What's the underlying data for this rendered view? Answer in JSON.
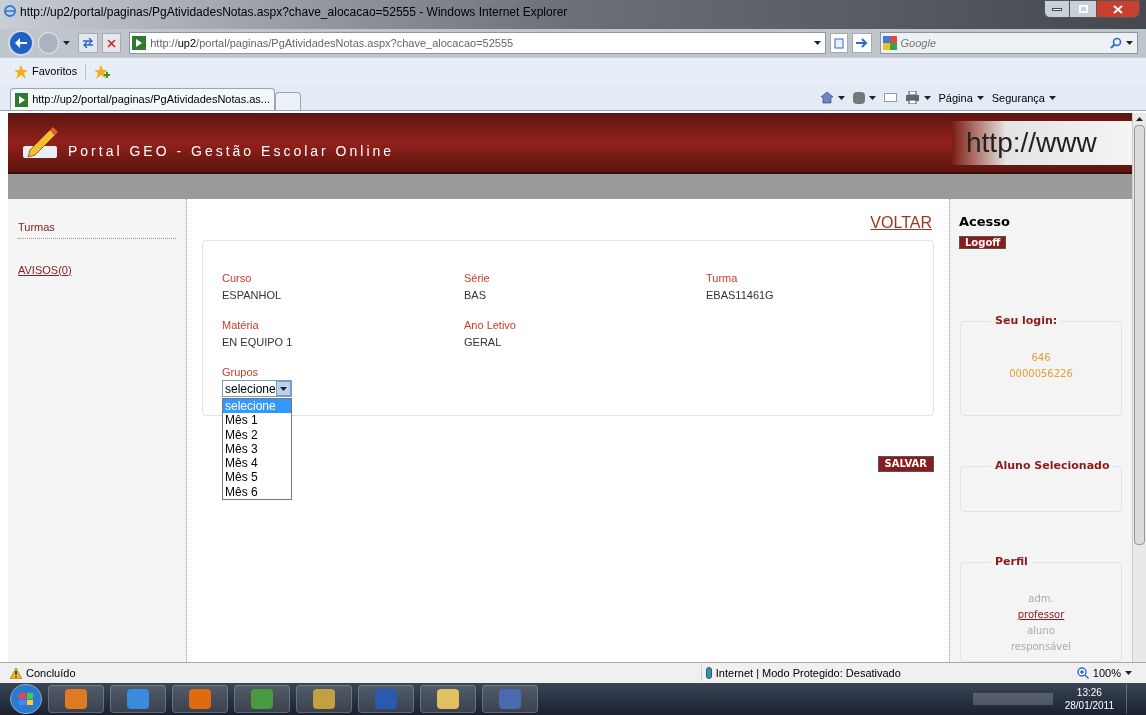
{
  "browser": {
    "title": "http://up2/portal/paginas/PgAtividadesNotas.aspx?chave_alocacao=52555 - Windows Internet Explorer",
    "address": {
      "prefix": "http://",
      "host": "up2",
      "path": "/portal/paginas/PgAtividadesNotas.aspx?chave_alocacao=52555"
    },
    "search": {
      "placeholder": "Google"
    },
    "favorites": "Favoritos",
    "tabs": [
      {
        "label": "http://up2/portal/paginas/PgAtividadesNotas.as...",
        "selected": true
      }
    ],
    "commands": [
      "Página",
      "Segurança"
    ]
  },
  "header": {
    "title": "Portal GEO - Gestão Escolar Online",
    "banner": "http://www"
  },
  "sidebar": {
    "items": [
      {
        "label": "Turmas",
        "kind": "heading"
      },
      {
        "label": "AVISOS(0)",
        "kind": "link"
      }
    ]
  },
  "main": {
    "back_link": "VOLTAR",
    "fields": [
      {
        "label": "Curso",
        "value": "ESPANHOL"
      },
      {
        "label": "Série",
        "value": "BAS"
      },
      {
        "label": "Turma",
        "value": "EBAS11461G"
      },
      {
        "label": "Matéria",
        "value": "EN EQUIPO 1"
      },
      {
        "label": "Ano Letivo",
        "value": "GERAL"
      }
    ],
    "groups": {
      "label": "Grupos",
      "value": "selecione",
      "expanded": true,
      "options": [
        {
          "label": "selecione",
          "selected": true
        },
        {
          "label": "Mês 1",
          "selected": false
        },
        {
          "label": "Mês 2",
          "selected": false
        },
        {
          "label": "Mês 3",
          "selected": false
        },
        {
          "label": "Mês 4",
          "selected": false
        },
        {
          "label": "Mês 5",
          "selected": false
        },
        {
          "label": "Mês 6",
          "selected": false
        }
      ]
    },
    "save_button": "SALVAR"
  },
  "right_panel": {
    "title": "Acesso",
    "logoff_button": "Logoff",
    "login": {
      "title": "Seu login:",
      "lines": [
        "646",
        "0000056226"
      ]
    },
    "selected_student": {
      "title": "Aluno Selecionado"
    },
    "profile": {
      "title": "Perfil",
      "options": [
        {
          "label": "adm.",
          "selected": false
        },
        {
          "label": "professor",
          "selected": true
        },
        {
          "label": "aluno",
          "selected": false
        },
        {
          "label": "responsável",
          "selected": false
        }
      ]
    }
  },
  "status_bar": {
    "status": "Concluído",
    "zone": "Internet | Modo Protegido: Desativado",
    "zoom": "100%"
  },
  "taskbar": {
    "time": "13:26",
    "date": "28/01/2011"
  }
}
